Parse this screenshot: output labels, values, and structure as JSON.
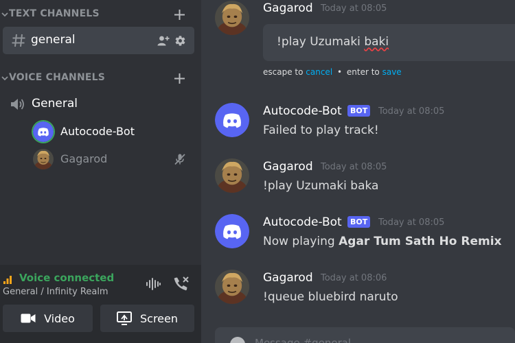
{
  "sidebar": {
    "text_category": "TEXT CHANNELS",
    "text_channels": [
      {
        "name": "general"
      }
    ],
    "voice_category": "VOICE CHANNELS",
    "voice_channels": [
      {
        "name": "General",
        "users": [
          {
            "name": "Autocode-Bot",
            "speaking": true
          },
          {
            "name": "Gagarod",
            "muted": true
          }
        ]
      }
    ]
  },
  "voice_panel": {
    "status": "Voice connected",
    "location": "General / Infinity Realm",
    "video_label": "Video",
    "screen_label": "Screen"
  },
  "messages": [
    {
      "author": "Gagarod",
      "time": "Today at 08:05",
      "editing": true,
      "edit_text_prefix": "!play Uzumaki ",
      "edit_text_misspelt": "baki",
      "edit_hint_escape": "escape to",
      "edit_hint_cancel": "cancel",
      "edit_hint_sep": "•",
      "edit_hint_enter": "enter to",
      "edit_hint_save": "save"
    },
    {
      "author": "Autocode-Bot",
      "bot_badge": "BOT",
      "time": "Today at 08:05",
      "text": "Failed to play track!"
    },
    {
      "author": "Gagarod",
      "time": "Today at 08:05",
      "text": "!play Uzumaki baka"
    },
    {
      "author": "Autocode-Bot",
      "bot_badge": "BOT",
      "time": "Today at 08:05",
      "text_prefix": "Now playing ",
      "text_bold": "Agar Tum Sath Ho Remix"
    },
    {
      "author": "Gagarod",
      "time": "Today at 08:06",
      "text": "!queue bluebird naruto"
    }
  ],
  "composer": {
    "placeholder": "Message #general"
  },
  "colors": {
    "sidebar_bg": "#2f3136",
    "chat_bg": "#36393f",
    "selected_channel": "#40444b",
    "voice_connected_green": "#3ba55d",
    "blurple": "#5865f2",
    "link": "#00aff4",
    "timestamp": "#72767d"
  },
  "icons": {
    "category_collapse": "chevron-down-icon",
    "create_channel": "plus-icon",
    "text_channel": "hash-icon",
    "invite": "add-member-icon",
    "settings": "gear-icon",
    "voice_channel": "speaker-icon",
    "muted": "microphone-off-icon",
    "signal": "signal-bars-icon",
    "noise": "soundwave-icon",
    "disconnect": "phone-disconnect-icon",
    "video": "camera-icon",
    "screen": "screen-share-icon",
    "bot_avatar": "discord-logo-icon"
  }
}
